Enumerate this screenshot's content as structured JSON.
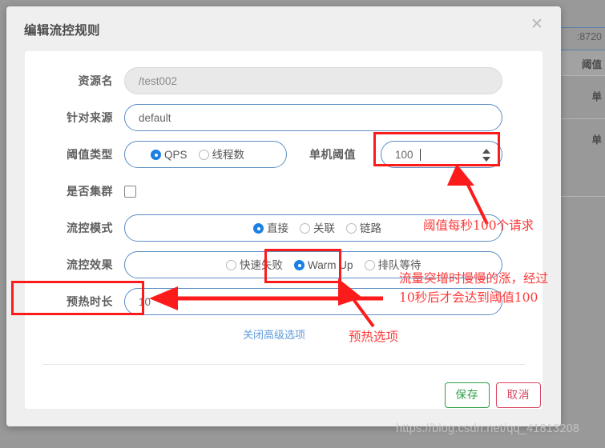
{
  "background": {
    "port_cell": ":8720",
    "header_threshold": "阈值",
    "row_cells": [
      "单",
      "单"
    ]
  },
  "dialog": {
    "title": "编辑流控规则",
    "close_icon": "close-icon",
    "fields": {
      "resource_name": {
        "label": "资源名",
        "value": "/test002",
        "disabled": true
      },
      "origin": {
        "label": "针对来源",
        "value": "default",
        "disabled": false
      },
      "threshold_type": {
        "label": "阈值类型",
        "options": [
          {
            "label": "QPS",
            "checked": true
          },
          {
            "label": "线程数",
            "checked": false
          }
        ]
      },
      "single_threshold": {
        "label": "单机阈值",
        "value": "100"
      },
      "is_cluster": {
        "label": "是否集群",
        "checked": false
      },
      "flow_mode": {
        "label": "流控模式",
        "options": [
          {
            "label": "直接",
            "checked": true
          },
          {
            "label": "关联",
            "checked": false
          },
          {
            "label": "链路",
            "checked": false
          }
        ]
      },
      "flow_effect": {
        "label": "流控效果",
        "options": [
          {
            "label": "快速失败",
            "checked": false
          },
          {
            "label": "Warm Up",
            "checked": true
          },
          {
            "label": "排队等待",
            "checked": false
          }
        ]
      },
      "warmup_duration": {
        "label": "预热时长",
        "value": "10"
      }
    },
    "advanced_link": "关闭高级选项",
    "buttons": {
      "save": "保存",
      "cancel": "取消"
    }
  },
  "annotations": {
    "threshold_note": "阈值每秒100个请求",
    "warmup_note_line1": "流量突增时慢慢的涨，经过",
    "warmup_note_line2": "10秒后才会达到阈值100",
    "warmup_option_note": "预热选项"
  },
  "watermark": "https://blog.csdn.net/qq_41813208",
  "colors": {
    "annotation_red": "#fd3a3a",
    "box_red": "#fc1b1b",
    "accent_blue": "#1b7fe3",
    "border_blue": "#5b8dc4",
    "save_green": "#2e9e44",
    "cancel_red": "#d9455f",
    "link_blue": "#5d9cde"
  }
}
